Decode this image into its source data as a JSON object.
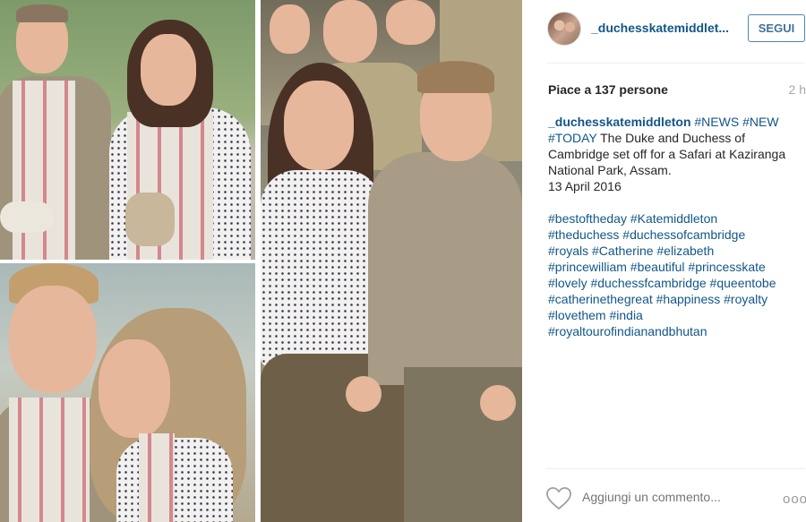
{
  "post": {
    "username": "_duchesskatemiddlet...",
    "follow_label": "SEGUI",
    "likes": "Piace a 137 persone",
    "time_ago": "2 h",
    "caption": {
      "author": "_duchesskatemiddleton",
      "lines": [
        "The Duke and Duchess of",
        "Cambridge set off for a Safari at Kaziranga",
        "National Park, Assam."
      ],
      "head_tags": [
        "#NEWS",
        "#NEW",
        "#TODAY"
      ],
      "date": "13 April 2016",
      "tag_lines": [
        "#bestoftheday #Katemiddleton",
        "#theduchess #duchessofcambridge",
        "#royals #Catherine #elizabeth",
        "#princewilliam #beautiful #princesskate",
        "#lovely #duchessfcambridge #queentobe",
        "#catherinethegreat #happiness #royalty",
        "#lovethem #india",
        "#royaltourofindianandbhutan"
      ]
    },
    "comment_placeholder": "Aggiungi un commento...",
    "more_label": "ooo"
  },
  "colors": {
    "link": "#125688",
    "follow_border": "#4c86b5",
    "muted": "#a5a7aa"
  },
  "icons": {
    "like": "heart-outline-icon",
    "options": "ellipsis-icon"
  }
}
